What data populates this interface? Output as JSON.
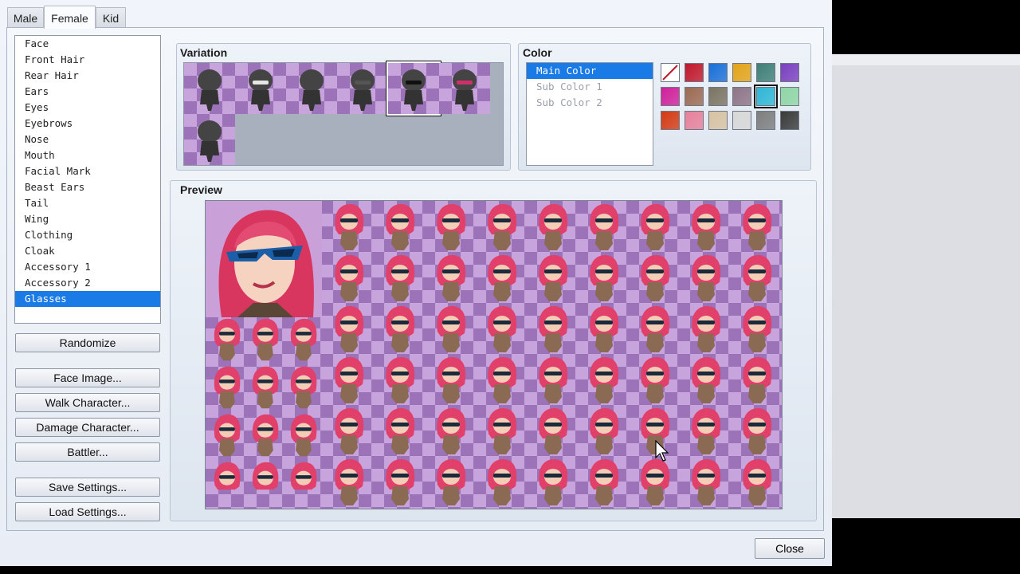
{
  "tabs": [
    "Male",
    "Female",
    "Kid"
  ],
  "active_tab": "Female",
  "parts": [
    "Face",
    "Front Hair",
    "Rear Hair",
    "Ears",
    "Eyes",
    "Eyebrows",
    "Nose",
    "Mouth",
    "Facial Mark",
    "Beast Ears",
    "Tail",
    "Wing",
    "Clothing",
    "Cloak",
    "Accessory 1",
    "Accessory 2",
    "Glasses"
  ],
  "selected_part": "Glasses",
  "buttons": {
    "randomize": "Randomize",
    "face_image": "Face Image...",
    "walk_character": "Walk Character...",
    "damage_character": "Damage Character...",
    "battler": "Battler...",
    "save_settings": "Save Settings...",
    "load_settings": "Load Settings...",
    "close": "Close"
  },
  "variation": {
    "title": "Variation",
    "selected_index": 4
  },
  "color": {
    "title": "Color",
    "items": [
      "Main Color",
      "Sub Color 1",
      "Sub Color 2"
    ],
    "selected": "Main Color",
    "swatches": [
      "none",
      "#c0182b",
      "#1a6fd8",
      "#e3a317",
      "#3f7f78",
      "#7a3fbf",
      "#d0209a",
      "#9b6a52",
      "#7b7462",
      "#8e7486",
      "#2eb7d6",
      "#8fd6a5",
      "#d43a12",
      "#e8809b",
      "#d8c3a3",
      "#d8d8d8",
      "#7e7e7e",
      "#3a3a3a"
    ],
    "selected_swatch": 10
  },
  "preview": {
    "title": "Preview"
  },
  "colors": {
    "accent": "#1a7be6",
    "checker_dark": "#9c72b8",
    "checker_light": "#c8a4dc",
    "hair": "#e0406a"
  }
}
